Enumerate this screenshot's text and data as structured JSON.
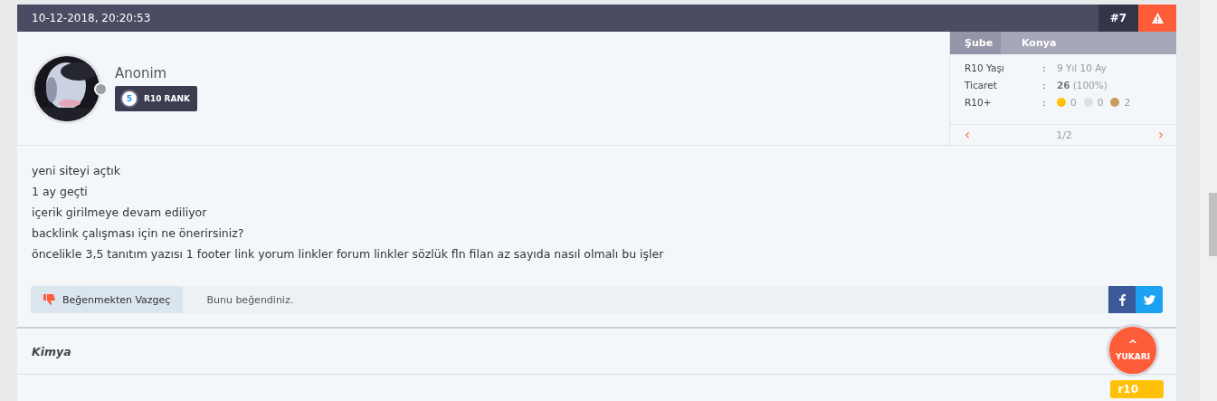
{
  "post": {
    "date": "10-12-2018, 20:20:53",
    "number": "#7"
  },
  "author": {
    "name": "Anonim",
    "rank_number": "5",
    "rank_label": "R10 RANK",
    "online": false
  },
  "info": {
    "branch_label": "Şube",
    "branch_value": "Konya",
    "rows": [
      {
        "kind": "text",
        "label": "R10 Yaşı",
        "sep": ":",
        "value": "9 Yıl 10 Ay"
      },
      {
        "kind": "trade",
        "label": "Ticaret",
        "sep": ":",
        "value": "26",
        "extra": "(100%)"
      },
      {
        "kind": "dots",
        "label": "R10+",
        "sep": ":",
        "dots": [
          {
            "color": "#ffc107",
            "count": "0"
          },
          {
            "color": "#e0e0e0",
            "count": "0"
          },
          {
            "color": "#c59d5f",
            "count": "2"
          }
        ]
      }
    ],
    "pager": {
      "prev": "‹",
      "page": "1/2",
      "next": "›"
    }
  },
  "body": [
    "yeni siteyi açtık",
    "1 ay geçti",
    "içerik girilmeye devam ediliyor",
    "backlink çalışması için ne önerirsiniz?",
    "öncelikle 3,5 tanıtım yazısı 1 footer link yorum linkler forum linkler sözlük fln filan az sayıda nasıl olmalı bu işler"
  ],
  "like_bar": {
    "button": "Beğenmekten Vazgeç",
    "liked": true,
    "note": "Bunu beğendiniz."
  },
  "signature": "Kimya",
  "badge": "r10",
  "scroll_top": {
    "arrow": "^",
    "label": "YUKARI"
  }
}
